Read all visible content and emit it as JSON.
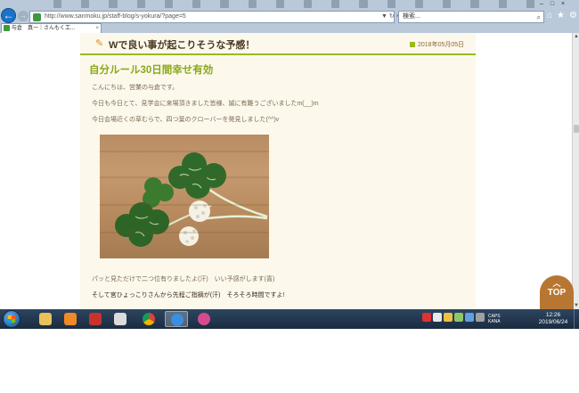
{
  "browser": {
    "url": "http://www.sanmoku.jp/staff-blog/s-yokura/?page=5",
    "search_placeholder": "検索...",
    "tab_title": "与倉　真一｜さんもく工...",
    "tab_close": "×",
    "back_glyph": "←",
    "forward_glyph": "→",
    "address_tools": "▼ ↻ ×",
    "search_glyph": "⌕",
    "nav_icons": [
      "⌂",
      "★",
      "⚙"
    ],
    "window_buttons": "– □ ×"
  },
  "post": {
    "title": "Wで良い事が起こりそうな予感！",
    "date": "2018年05月05日",
    "headline": "自分ルール30日間幸せ有効",
    "paragraphs": [
      "こんにちは、営業の与倉です。",
      "今日も今日とて、見学会に来場頂きました皆様、誠に有難うございましたm(__)m",
      "今日会場近くの草むらで、四つ葉のクローバーを発見しました(^^)v",
      "パッと見ただけで二つ位有りましたよ(汗)　いい予感がします(喜)",
      "そして宮ひょっこりさんから先程ご指摘が(汗)　そろそろ時間ですよ!"
    ],
    "photo_alt": "four-leaf clover and white clover flowers on wood"
  },
  "page_widgets": {
    "top_label": "TOP",
    "top_chevron": "︿"
  },
  "scrollbar": {
    "up_glyph": "▲",
    "down_glyph": "▼"
  },
  "taskbar": {
    "apps": [
      "file-explorer",
      "media-player",
      "mail",
      "chrome",
      "internet-explorer",
      "paint"
    ],
    "tray_label": "CAPS\nKANA",
    "time": "12:26",
    "date": "2019/06/24"
  },
  "colors": {
    "accent_green": "#8aa81a",
    "rule_green": "#9bb820",
    "content_bg": "#fdf8ec",
    "top_button": "#b87633",
    "taskbar": "#1b2c40"
  }
}
